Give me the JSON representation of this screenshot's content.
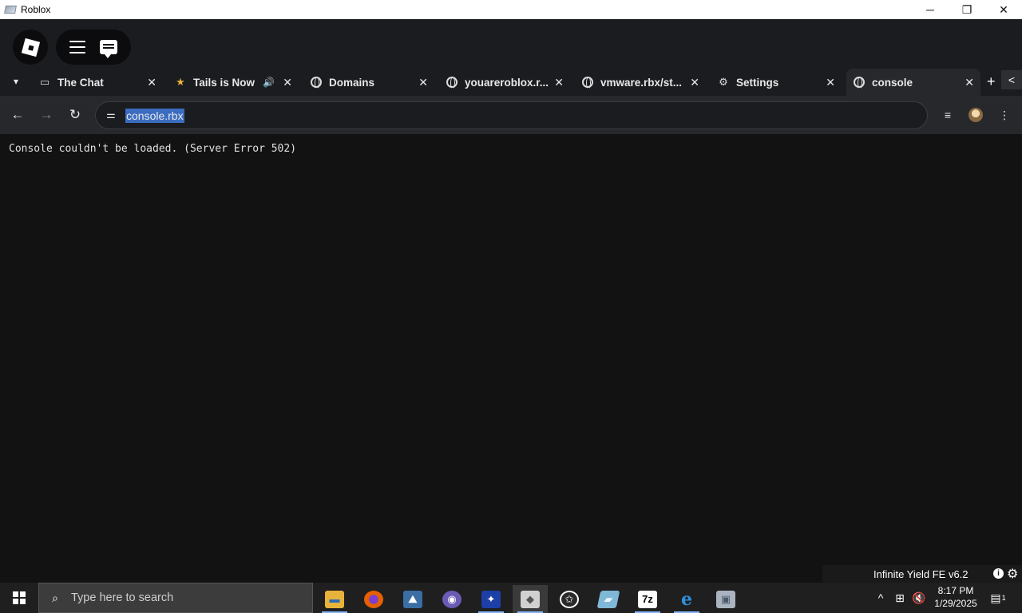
{
  "window": {
    "title": "Roblox",
    "minimize_glyph": "─",
    "restore_glyph": "❐",
    "close_glyph": "✕"
  },
  "topbar": {
    "logo": "roblox-logo",
    "menu_icon": "hamburger-menu-icon",
    "chat_icon": "chat-icon"
  },
  "tabs": [
    {
      "label": "The Chat",
      "icon": "chat-bubble-icon",
      "active": false
    },
    {
      "label": "Tails is Now",
      "icon": "tails-icon",
      "active": false,
      "audio": true
    },
    {
      "label": "Domains",
      "icon": "globe-icon",
      "active": false
    },
    {
      "label": "youareroblox.r...",
      "icon": "globe-icon",
      "active": false
    },
    {
      "label": "vmware.rbx/st...",
      "icon": "globe-icon",
      "active": false
    },
    {
      "label": "Settings",
      "icon": "gear-icon",
      "active": false
    },
    {
      "label": "console",
      "icon": "globe-icon",
      "active": true
    }
  ],
  "tab_glyphs": {
    "close": "✕",
    "dropdown": "▾",
    "new_tab": "+",
    "scroll": "<",
    "speaker": "🔊"
  },
  "navbar": {
    "back_glyph": "←",
    "forward_glyph": "→",
    "reload_glyph": "↻",
    "site_settings_glyph": "⚌",
    "url": "console.rbx",
    "media_glyph": "≡",
    "menu_glyph": "⋮"
  },
  "content": {
    "message": "Console couldn't be loaded. (Server Error 502)"
  },
  "infinite_yield": {
    "title": "Infinite Yield FE v6.2",
    "info_glyph": "i",
    "gear_glyph": "⚙"
  },
  "taskbar": {
    "search_placeholder": "Type here to search",
    "search_glyph": "⌕",
    "apps": [
      {
        "name": "file-explorer",
        "glyph": "▬",
        "color": "#e8b33a"
      },
      {
        "name": "firefox",
        "glyph": "●",
        "color": "#e66000"
      },
      {
        "name": "game-2025",
        "glyph": "⛰",
        "color": "#3a6ea5"
      },
      {
        "name": "purple-app",
        "glyph": "◉",
        "color": "#6b5bb5"
      },
      {
        "name": "blue-app",
        "glyph": "✦",
        "color": "#1c3fa8"
      },
      {
        "name": "roblox",
        "glyph": "◆",
        "color": "#d0d0d0"
      },
      {
        "name": "star-app",
        "glyph": "✩",
        "color": "#2a2a2a"
      },
      {
        "name": "notes-app",
        "glyph": "▰",
        "color": "#7fb8d6"
      },
      {
        "name": "7zip",
        "glyph": "7z",
        "color": "#ffffff"
      },
      {
        "name": "edge-legacy",
        "glyph": "e",
        "color": "#2f8fdd"
      },
      {
        "name": "remote-app",
        "glyph": "▣",
        "color": "#aab4c0"
      }
    ],
    "tray": {
      "chevron_glyph": "^",
      "network_glyph": "⊞",
      "volume_glyph": "🔇",
      "notification_glyph": "▤",
      "notification_count": "1"
    },
    "time": "8:17 PM",
    "date": "1/29/2025"
  }
}
